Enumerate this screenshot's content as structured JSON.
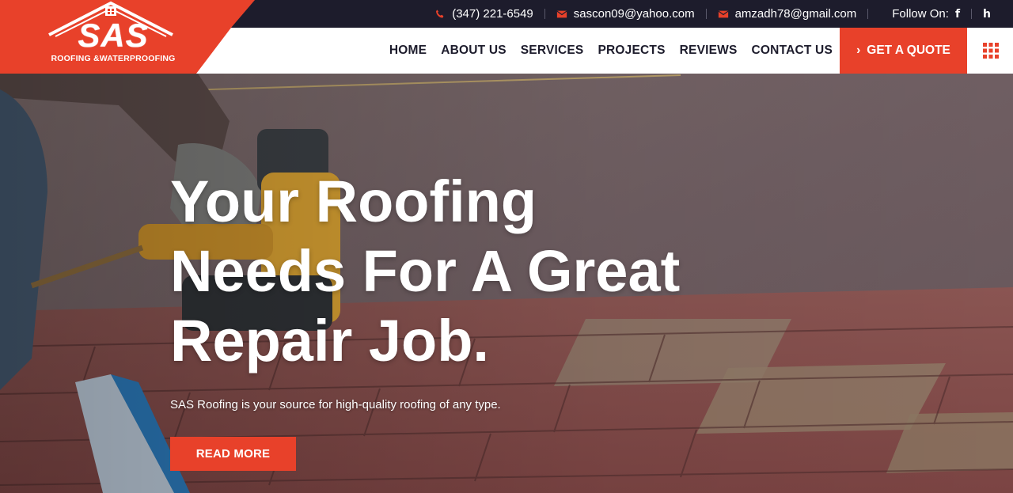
{
  "colors": {
    "accent": "#e8412a",
    "dark": "#1d1c2c",
    "white": "#ffffff"
  },
  "topbar": {
    "phone": "(347) 221-6549",
    "email1": "sascon09@yahoo.com",
    "email2": "amzadh78@gmail.com",
    "follow_label": "Follow On:",
    "social": [
      {
        "icon": "facebook-icon",
        "glyph": "f"
      },
      {
        "icon": "houzz-icon",
        "glyph": "h"
      }
    ]
  },
  "logo": {
    "name": "SAS",
    "tagline": "ROOFING &WATERPROOFING"
  },
  "nav": {
    "items": [
      "HOME",
      "ABOUT US",
      "SERVICES",
      "PROJECTS",
      "REVIEWS",
      "CONTACT US"
    ],
    "quote_label": "GET A QUOTE",
    "quote_arrow": "›"
  },
  "hero": {
    "title_lines": [
      "Your Roofing",
      "Needs For A Great",
      "Repair Job."
    ],
    "subtitle": "SAS Roofing is your source for high-quality roofing of any type.",
    "button_label": "READ MORE"
  }
}
